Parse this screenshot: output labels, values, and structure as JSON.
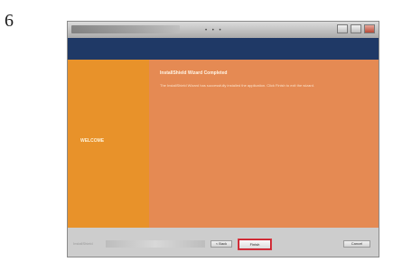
{
  "step_number": "6",
  "window": {
    "buttons": [
      "minimize-icon",
      "maximize-icon",
      "close-icon"
    ]
  },
  "wizard": {
    "heading": "InstallShield Wizard Completed",
    "body": "The InstallShield Wizard has successfully installed the application. Click Finish to exit the wizard.",
    "side_label": "WELCOME"
  },
  "footer": {
    "left_text": "InstallShield",
    "back_label": "< Back",
    "next_label": "Finish",
    "cancel_label": "Cancel"
  },
  "colors": {
    "banner": "#1f3966",
    "left_panel": "#e8922a",
    "right_panel": "#e58a53",
    "highlight": "#c81f2b"
  }
}
